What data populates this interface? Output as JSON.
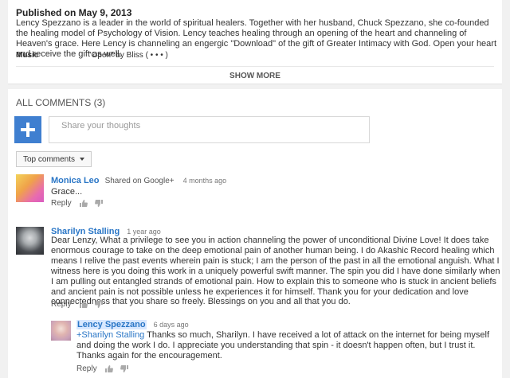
{
  "description": {
    "published": "Published on May 9, 2013",
    "text": "Lency Spezzano is a leader in the world of spiritual healers. Together with her husband, Chuck Spezzano, she co-founded the healing model of Psychology of Vision. Lency teaches healing through an opening of the heart and channeling of Heaven's grace. Here Lency is channeling an engergic \"Download\" of the gift of Greater Intimacy with God. Open your heart and receive the gift as well.",
    "music_label": "Music",
    "music_value": "\"Open\" by Bliss ( • • • )",
    "show_more": "SHOW MORE"
  },
  "comments_section": {
    "header": "ALL COMMENTS (3)",
    "share_placeholder": "Share your thoughts",
    "sort_label": "Top comments"
  },
  "comments": [
    {
      "author": "Monica Leo",
      "shared": "Shared on Google+",
      "time": "4 months ago",
      "text": "Grace...",
      "reply": "Reply"
    },
    {
      "author": "Sharilyn Stalling",
      "time": "1 year ago",
      "text": "Dear Lenzy, What a privilege to see you in action channeling the power of unconditional Divine Love! It does take enormous courage to take on the deep emotional pain of another human being. I do Akashic Record healing which means I relive the past events wherein pain is stuck; I am the person of the past in all the emotional anguish. What I witness here is you doing this work in a uniquely powerful swift manner. The spin you did I have done similarly when I am pulling out entangled strands of emotional pain. How to explain this to someone who is stuck in ancient beliefs and ancient pain is not possible unless he experiences it for himself. Thank you for your dedication and love connectedness that you share so freely. Blessings on you and all that you do.",
      "reply": "Reply"
    }
  ],
  "reply_comment": {
    "author": "Lency Spezzano",
    "time": "6 days ago",
    "mention": "+Sharilyn Stalling",
    "text": " Thanks so much, Sharilyn. I have received a lot of attack on the internet for being myself and doing the work I do. I appreciate you understanding that spin - it doesn't happen often, but I trust it. Thanks again for the encouragement.",
    "reply": "Reply"
  },
  "colors": {
    "link": "#2a76c6",
    "share_avatar": "#3f7fd0"
  }
}
